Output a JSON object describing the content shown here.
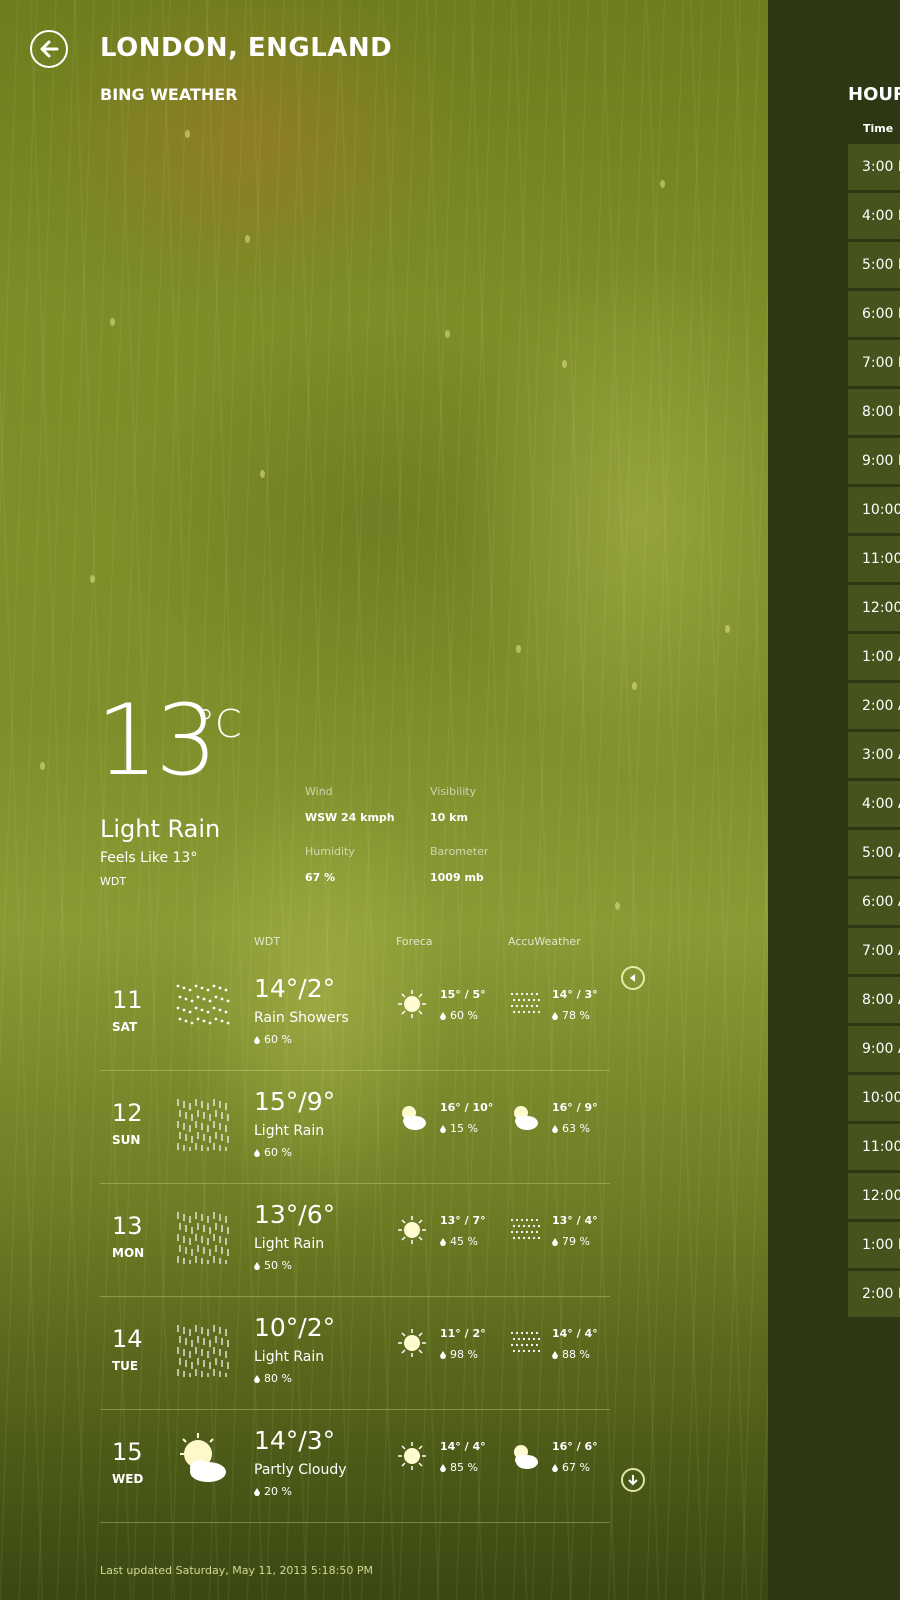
{
  "header": {
    "title": "LONDON, ENGLAND",
    "subtitle": "BING WEATHER"
  },
  "current": {
    "temperature": "13",
    "unit": "°C",
    "condition": "Light Rain",
    "feels_like": "Feels Like 13°",
    "provider": "WDT",
    "details": {
      "wind_label": "Wind",
      "wind_value": "WSW 24 kmph",
      "visibility_label": "Visibility",
      "visibility_value": "10 km",
      "humidity_label": "Humidity",
      "humidity_value": "67 %",
      "barometer_label": "Barometer",
      "barometer_value": "1009 mb"
    }
  },
  "forecast": {
    "sources": [
      "WDT",
      "Foreca",
      "AccuWeather"
    ],
    "days": [
      {
        "date": "11",
        "dow": "SAT",
        "icon": "rain-showers-icon",
        "temp": "14°/2°",
        "condition": "Rain Showers",
        "precip": "60 %",
        "foreca": {
          "icon": "sun-icon",
          "temp": "15° / 5°",
          "precip": "60 %"
        },
        "accu": {
          "icon": "rain-icon",
          "temp": "14° / 3°",
          "precip": "78 %"
        }
      },
      {
        "date": "12",
        "dow": "SUN",
        "icon": "light-rain-icon",
        "temp": "15°/9°",
        "condition": "Light Rain",
        "precip": "60 %",
        "foreca": {
          "icon": "sun-cloud-icon",
          "temp": "16° / 10°",
          "precip": "15 %"
        },
        "accu": {
          "icon": "sun-cloud-icon",
          "temp": "16° / 9°",
          "precip": "63 %"
        }
      },
      {
        "date": "13",
        "dow": "MON",
        "icon": "light-rain-icon",
        "temp": "13°/6°",
        "condition": "Light Rain",
        "precip": "50 %",
        "foreca": {
          "icon": "sun-icon",
          "temp": "13° / 7°",
          "precip": "45 %"
        },
        "accu": {
          "icon": "rain-icon",
          "temp": "13° / 4°",
          "precip": "79 %"
        }
      },
      {
        "date": "14",
        "dow": "TUE",
        "icon": "light-rain-icon",
        "temp": "10°/2°",
        "condition": "Light Rain",
        "precip": "80 %",
        "foreca": {
          "icon": "sun-icon",
          "temp": "11° / 2°",
          "precip": "98 %"
        },
        "accu": {
          "icon": "rain-icon",
          "temp": "14° / 4°",
          "precip": "88 %"
        }
      },
      {
        "date": "15",
        "dow": "WED",
        "icon": "partly-cloudy-icon",
        "temp": "14°/3°",
        "condition": "Partly Cloudy",
        "precip": "20 %",
        "foreca": {
          "icon": "sun-icon",
          "temp": "14° / 4°",
          "precip": "85 %"
        },
        "accu": {
          "icon": "sun-cloud-icon",
          "temp": "16° / 6°",
          "precip": "67 %"
        }
      }
    ]
  },
  "footer": {
    "last_updated": "Last updated Saturday, May 11, 2013 5:18:50 PM"
  },
  "hourly": {
    "title": "HOUR",
    "column": "Time",
    "rows": [
      "3:00 P",
      "4:00 P",
      "5:00 P",
      "6:00 P",
      "7:00 P",
      "8:00 P",
      "9:00 P",
      "10:00",
      "11:00",
      "12:00",
      "1:00 A",
      "2:00 A",
      "3:00 A",
      "4:00 A",
      "5:00 A",
      "6:00 A",
      "7:00 A",
      "8:00 A",
      "9:00 A",
      "10:00",
      "11:00",
      "12:00",
      "1:00 P",
      "2:00 P"
    ]
  }
}
